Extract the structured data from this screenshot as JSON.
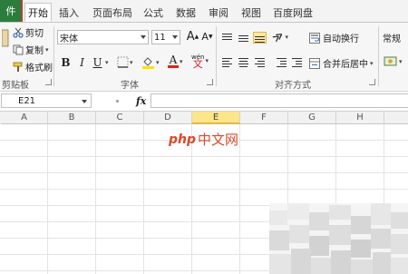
{
  "tabs": {
    "file": "件",
    "items": [
      "开始",
      "插入",
      "页面布局",
      "公式",
      "数据",
      "审阅",
      "视图",
      "百度网盘"
    ],
    "active_index": 0
  },
  "clipboard": {
    "cut": "剪切",
    "copy": "复制",
    "format_painter": "格式刷",
    "label": "剪贴板"
  },
  "font": {
    "name": "宋体",
    "size": "11",
    "label": "字体",
    "bold": "B",
    "italic": "I",
    "underline": "U",
    "grow": "A",
    "shrink": "A",
    "color_letter": "A",
    "phonetic": "wén"
  },
  "alignment": {
    "wrap_text": "自动换行",
    "merge_center": "合并后居中",
    "label": "对齐方式"
  },
  "number": {
    "format": "常规"
  },
  "formula_bar": {
    "name_box": "E21",
    "fx": "fx",
    "formula": ""
  },
  "columns": [
    "A",
    "B",
    "C",
    "D",
    "E",
    "F",
    "G",
    "H"
  ],
  "selected_column": "E",
  "watermark": {
    "php": "php",
    "cn": "中文网"
  },
  "colors": {
    "file_tab": "#2a7d3c",
    "selected_header": "#fde58a",
    "font_color_bar": "#e2231a",
    "highlight_bar": "#ffe100",
    "watermark": "#d94a2a"
  }
}
